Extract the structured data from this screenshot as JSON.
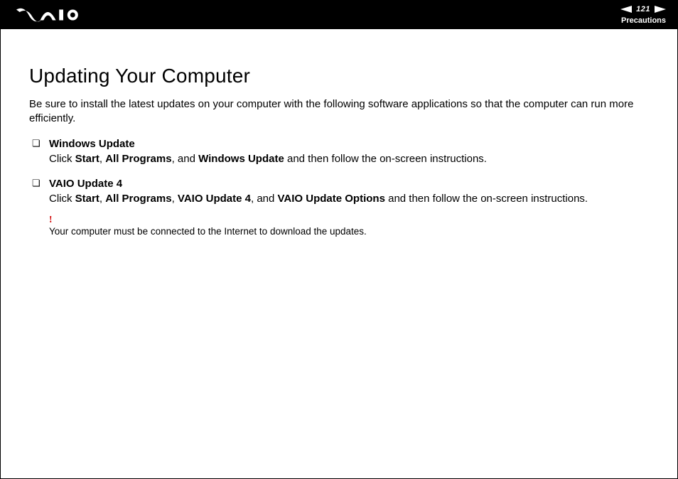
{
  "header": {
    "page_number": "121",
    "section": "Precautions"
  },
  "title": "Updating Your Computer",
  "lead": "Be sure to install the latest updates on your computer with the following software applications so that the computer can run more efficiently.",
  "items": [
    {
      "title": "Windows Update",
      "pre": "Click ",
      "b1": "Start",
      "mid1": ", ",
      "b2": "All Programs",
      "mid2": ", and ",
      "b3": "Windows Update",
      "post": " and then follow the on-screen instructions."
    },
    {
      "title": "VAIO Update 4",
      "pre": "Click ",
      "b1": "Start",
      "mid1": ", ",
      "b2": "All Programs",
      "mid2": ", ",
      "b3": "VAIO Update 4",
      "mid3": ", and ",
      "b4": "VAIO Update Options",
      "post": " and then follow the on-screen instructions."
    }
  ],
  "note": {
    "bang": "!",
    "text": "Your computer must be connected to the Internet to download the updates."
  }
}
